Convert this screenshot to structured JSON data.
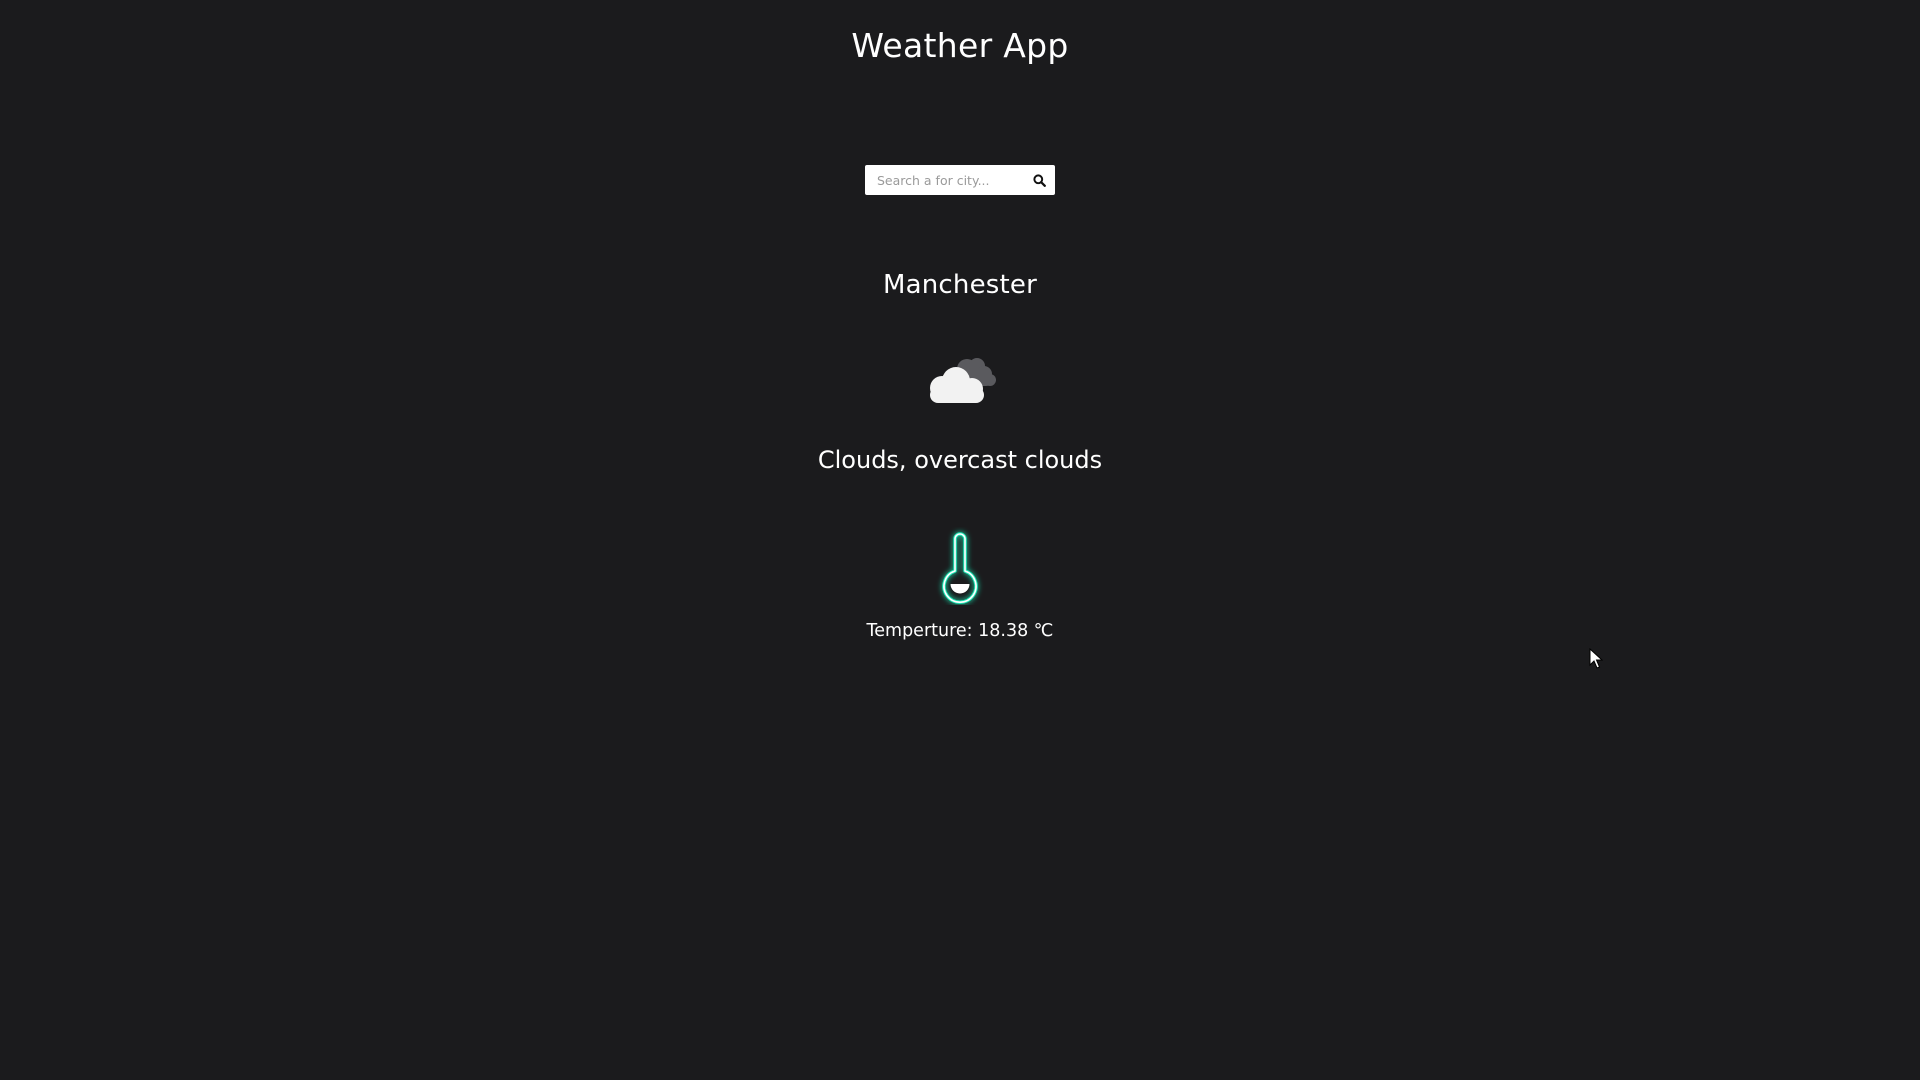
{
  "header": {
    "title": "Weather App"
  },
  "search": {
    "placeholder": "Search a for city...",
    "value": "",
    "icon": "search-icon"
  },
  "weather": {
    "city": "Manchester",
    "icon": "cloud-icon",
    "description": "Clouds, overcast clouds",
    "temperature_icon": "thermometer-icon",
    "temperature_text": "Temperture: 18.38 ℃"
  },
  "colors": {
    "background": "#1b1b1d",
    "text": "#ffffff",
    "thermometer_glow": "#1de9b6"
  }
}
